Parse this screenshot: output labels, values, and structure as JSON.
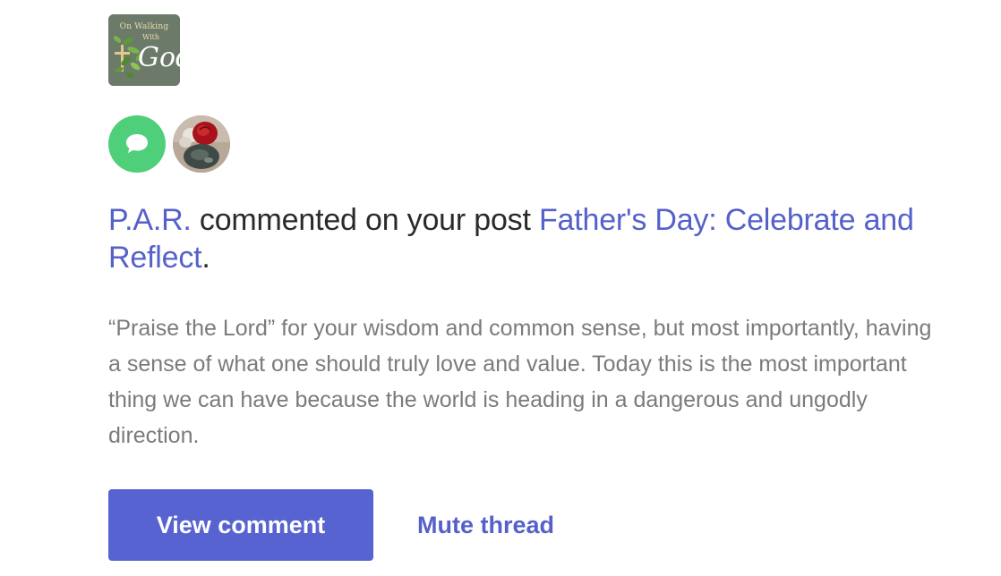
{
  "site": {
    "logo_line1": "On Walking",
    "logo_line2": "With",
    "logo_line3": "God"
  },
  "notification": {
    "icon": "comment-bubble-icon",
    "badge_color": "#4fcf7a",
    "commenter": "P.A.R.",
    "action_text": " commented on your post ",
    "post_title": "Father's Day: Celebrate and Reflect",
    "trailing": ".",
    "excerpt": "“Praise the Lord” for your wisdom and common sense, but most importantly, having a sense of what one should truly love and value. Today this is the most important thing we can have because the world is heading in a dangerous and ungodly direction."
  },
  "actions": {
    "view_comment_label": "View comment",
    "mute_thread_label": "Mute thread"
  },
  "colors": {
    "link": "#5561c9",
    "button": "#5663d1",
    "excerpt_text": "#7b7b7b"
  }
}
